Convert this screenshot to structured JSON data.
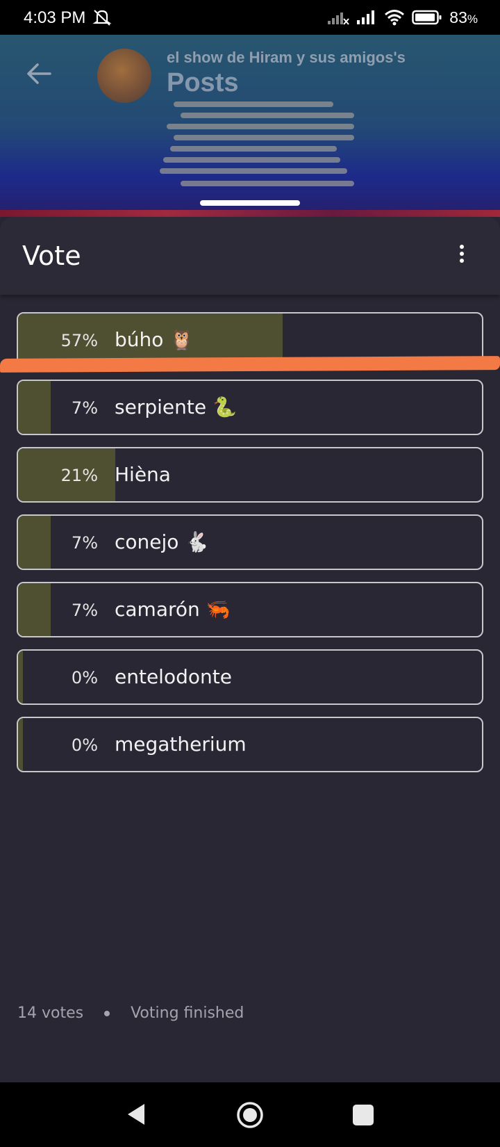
{
  "status_bar": {
    "time": "4:03 PM",
    "battery_percent": "83",
    "battery_suffix": "%",
    "icons": [
      "mute-icon",
      "signal-x-icon",
      "signal-icon",
      "wifi-icon",
      "battery-icon"
    ]
  },
  "header": {
    "subtitle": "el show de Hiram y sus amigos's",
    "title": "Posts"
  },
  "sheet": {
    "title": "Vote",
    "options": [
      {
        "percent_label": "57%",
        "label": "búho 🦉",
        "fill": 0.57
      },
      {
        "percent_label": "7%",
        "label": "serpiente 🐍",
        "fill": 0.07
      },
      {
        "percent_label": "21%",
        "label": "Hièna",
        "fill": 0.21
      },
      {
        "percent_label": "7%",
        "label": "conejo 🐇",
        "fill": 0.07
      },
      {
        "percent_label": "7%",
        "label": "camarón 🦐",
        "fill": 0.07
      },
      {
        "percent_label": "0%",
        "label": "entelodonte",
        "fill": 0.0
      },
      {
        "percent_label": "0%",
        "label": "megatherium",
        "fill": 0.0
      }
    ],
    "votes": "14 votes",
    "status": "Voting finished"
  },
  "colors": {
    "background": "#292733",
    "bar_fill": "#4f5032",
    "annotation": "#f37a45"
  }
}
